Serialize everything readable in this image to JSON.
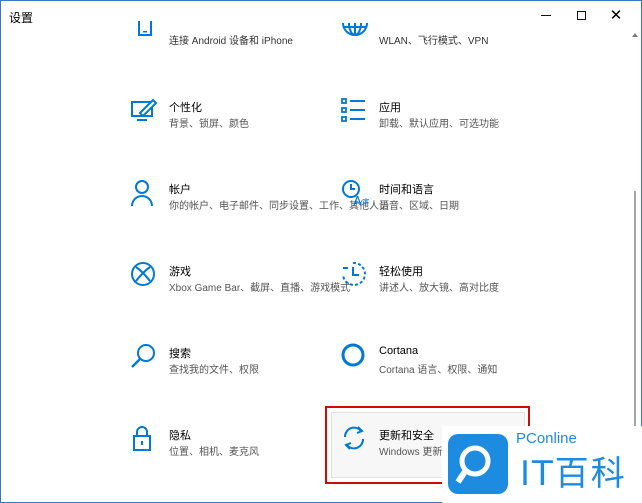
{
  "window": {
    "title": "设置",
    "min_label": "",
    "max_label": "",
    "close_label": "✕"
  },
  "colors": {
    "accent": "#0078d7",
    "highlight_border": "#d00a0a",
    "watermark_blue": "#1d8ce0"
  },
  "tiles": [
    {
      "name": "",
      "desc": "连接 Android 设备和 iPhone",
      "icon": "phone-icon"
    },
    {
      "name": "",
      "desc": "WLAN、飞行模式、VPN",
      "icon": "globe-icon"
    },
    {
      "name": "个性化",
      "desc": "背景、锁屏、颜色",
      "icon": "personalization-icon"
    },
    {
      "name": "应用",
      "desc": "卸载、默认应用、可选功能",
      "icon": "apps-icon"
    },
    {
      "name": "帐户",
      "desc": "你的帐户、电子邮件、同步设置、工作、其他人员",
      "icon": "account-icon"
    },
    {
      "name": "时间和语言",
      "desc": "语音、区域、日期",
      "icon": "time-language-icon"
    },
    {
      "name": "游戏",
      "desc": "Xbox Game Bar、截屏、直播、游戏模式",
      "icon": "xbox-icon"
    },
    {
      "name": "轻松使用",
      "desc": "讲述人、放大镜、高对比度",
      "icon": "ease-of-access-icon"
    },
    {
      "name": "搜索",
      "desc": "查找我的文件、权限",
      "icon": "search-icon"
    },
    {
      "name": "Cortana",
      "desc": "Cortana 语言、权限、通知",
      "icon": "cortana-icon"
    },
    {
      "name": "隐私",
      "desc": "位置、相机、麦克风",
      "icon": "lock-icon"
    },
    {
      "name": "更新和安全",
      "desc": "Windows 更新",
      "icon": "update-icon"
    }
  ],
  "watermark": {
    "brand": "PConline",
    "text": "IT百科"
  }
}
